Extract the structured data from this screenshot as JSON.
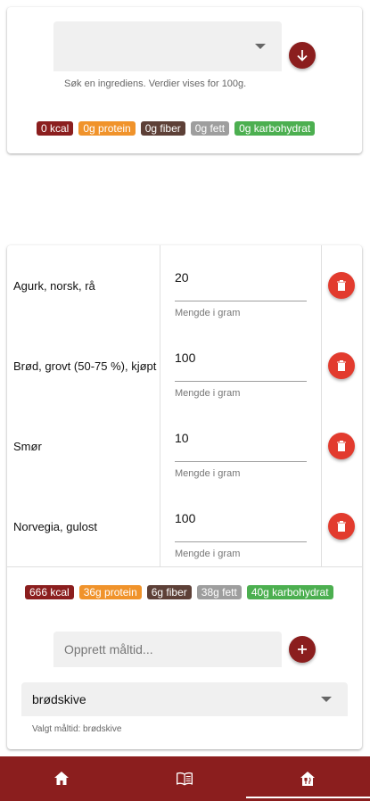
{
  "search": {
    "helper_text": "Søk en ingrediens. Verdier vises for 100g.",
    "add_icon": "arrow-down-icon"
  },
  "search_nutrition": [
    {
      "label": "0 kcal",
      "color": "#8b1e1e"
    },
    {
      "label": "0g protein",
      "color": "#f0932b"
    },
    {
      "label": "0g fiber",
      "color": "#5d4037"
    },
    {
      "label": "0g fett",
      "color": "#9e9e9e"
    },
    {
      "label": "0g karbohydrat",
      "color": "#4caf50"
    }
  ],
  "ingredients": [
    {
      "name": "Agurk, norsk, rå",
      "amount": "20",
      "amount_label": "Mengde i gram"
    },
    {
      "name": "Brød, grovt (50-75 %), kjøpt",
      "amount": "100",
      "amount_label": "Mengde i gram"
    },
    {
      "name": "Smør",
      "amount": "10",
      "amount_label": "Mengde i gram"
    },
    {
      "name": "Norvegia, gulost",
      "amount": "100",
      "amount_label": "Mengde i gram"
    }
  ],
  "meal_nutrition": [
    {
      "label": "666 kcal",
      "color": "#8b1e1e"
    },
    {
      "label": "36g protein",
      "color": "#f0932b"
    },
    {
      "label": "6g fiber",
      "color": "#5d4037"
    },
    {
      "label": "38g fett",
      "color": "#9e9e9e"
    },
    {
      "label": "40g karbohydrat",
      "color": "#4caf50"
    }
  ],
  "create_meal": {
    "placeholder": "Opprett måltid..."
  },
  "meal_select": {
    "value": "brødskive",
    "helper_text": "Valgt måltid: brødskive"
  },
  "nav": {
    "items": [
      "home-icon",
      "book-icon",
      "meal-house-icon"
    ],
    "active_index": 2
  }
}
